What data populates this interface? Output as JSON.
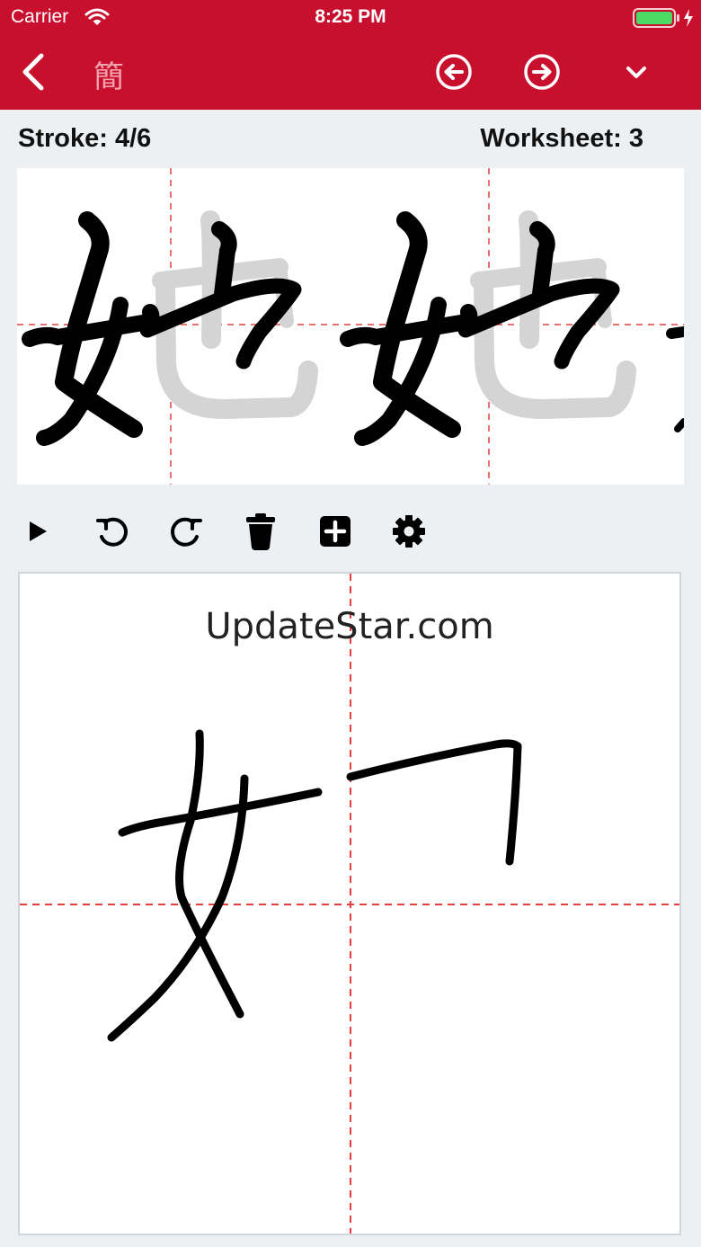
{
  "status_bar": {
    "carrier": "Carrier",
    "time": "8:25 PM"
  },
  "nav": {
    "trad_toggle": "簡",
    "icons": [
      "back-icon",
      "previous-character-icon",
      "next-character-icon",
      "chevron-down-icon"
    ]
  },
  "info": {
    "stroke": "Stroke: 4/6",
    "worksheet": "Worksheet: 3"
  },
  "worksheet": {
    "character": "她",
    "repetitions": 2
  },
  "toolbar": {
    "tools": [
      "play-icon",
      "undo-icon",
      "redo-icon",
      "trash-icon",
      "add-icon",
      "gear-icon"
    ]
  },
  "practice": {
    "watermark": "UpdateStar.com"
  },
  "colors": {
    "header": "#c8102e",
    "guide_lines": "#e04040",
    "trace_gray": "#d0d0d0",
    "background": "#edf0f3"
  }
}
